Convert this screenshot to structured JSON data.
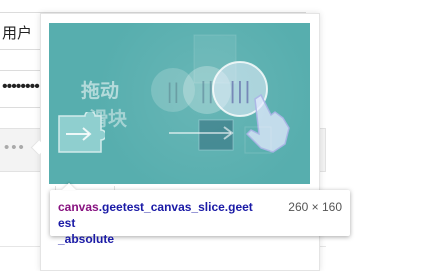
{
  "form": {
    "username_text": "用户",
    "password_dots": "••••••••",
    "slider_dots": "•••"
  },
  "captcha": {
    "canvas_text_line1": "拖动",
    "canvas_text_line2": "滑块",
    "icon_glyphs": [
      "||",
      "||",
      "|||"
    ],
    "colors": {
      "canvas_bg": "#57aeae",
      "piece_fill": "#8fcfcf"
    }
  },
  "inspector": {
    "tag": "canvas",
    "selector_line1": ".geetest_canvas_slice.geetest",
    "selector_line2": "_absolute",
    "size": "260 × 160"
  }
}
